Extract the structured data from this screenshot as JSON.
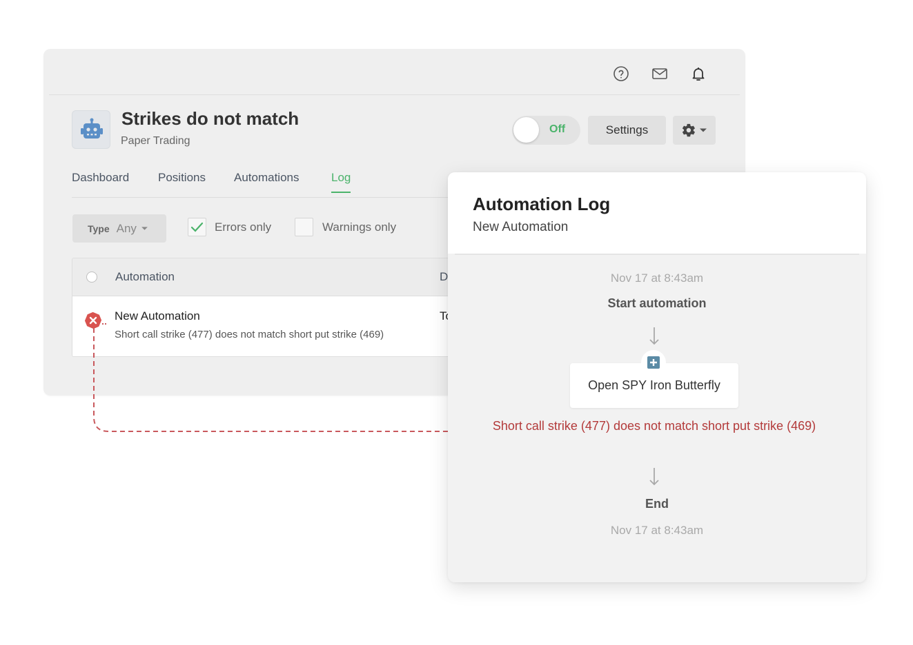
{
  "header": {
    "title": "Strikes do not match",
    "subtitle": "Paper Trading",
    "toggle_label": "Off",
    "settings_label": "Settings"
  },
  "tabs": [
    {
      "label": "Dashboard"
    },
    {
      "label": "Positions"
    },
    {
      "label": "Automations"
    },
    {
      "label": "Log"
    }
  ],
  "filters": {
    "type_label": "Type",
    "type_value": "Any",
    "errors_only_label": "Errors only",
    "errors_only_checked": true,
    "warnings_only_label": "Warnings only",
    "warnings_only_checked": false
  },
  "table": {
    "columns": [
      "Automation",
      "D"
    ],
    "rows": [
      {
        "title": "New Automation",
        "description": "Short call strike (477) does not match short put strike (469)",
        "col2": "To",
        "status": "error"
      }
    ]
  },
  "log_panel": {
    "title": "Automation Log",
    "subtitle": "New Automation",
    "start_time": "Nov 17 at 8:43am",
    "start_label": "Start automation",
    "action_label": "Open SPY Iron Butterfly",
    "error_message": "Short call strike (477) does not match short put strike (469)",
    "end_label": "End",
    "end_time": "Nov 17 at 8:43am"
  },
  "colors": {
    "accent_green": "#4bb36b",
    "error_red": "#b33a3a",
    "action_blue": "#5b8ba5"
  },
  "icons": [
    "help-icon",
    "mail-icon",
    "bell-icon",
    "robot-icon",
    "gear-icon",
    "chevron-down-icon",
    "check-icon",
    "error-icon",
    "plus-icon",
    "arrow-down-icon"
  ]
}
